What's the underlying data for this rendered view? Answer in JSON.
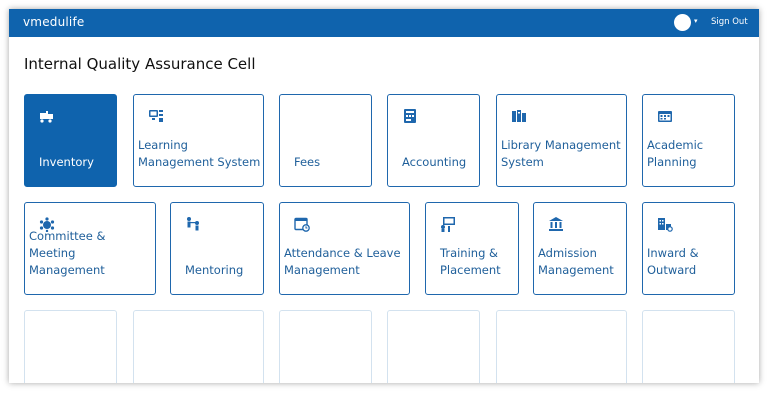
{
  "app": {
    "brand": "vmedulife"
  },
  "header": {
    "sign_out": "Sign Out",
    "caret": "▾"
  },
  "page": {
    "title": "Internal Quality Assurance Cell"
  },
  "colors": {
    "primary": "#0f63ad",
    "tile_text": "#1f5f9a",
    "empty_border": "#d3e2ef"
  },
  "tiles": [
    {
      "label": "Inventory",
      "icon": "forklift-icon"
    },
    {
      "label": "Learning Management System",
      "icon": "lms-icon"
    },
    {
      "label": "Fees",
      "icon": ""
    },
    {
      "label": "Accounting",
      "icon": "accounting-icon"
    },
    {
      "label": "Library Management System",
      "icon": "library-icon"
    },
    {
      "label": "Academic Planning",
      "icon": "calendar-icon"
    },
    {
      "label": "Committee & Meeting Management",
      "icon": "committee-icon"
    },
    {
      "label": "Mentoring",
      "icon": "mentoring-icon"
    },
    {
      "label": "Attendance & Leave Management",
      "icon": "attendance-icon"
    },
    {
      "label": "Training & Placement",
      "icon": "training-icon"
    },
    {
      "label": "Admission Management",
      "icon": "admission-icon"
    },
    {
      "label": "Inward & Outward",
      "icon": "inward-outward-icon"
    }
  ]
}
